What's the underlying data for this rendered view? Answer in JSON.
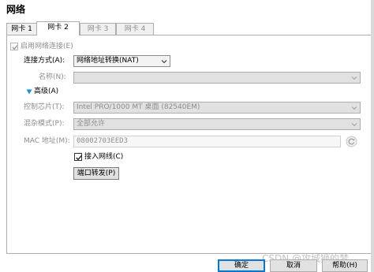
{
  "dialog": {
    "title": "网络"
  },
  "tabs": [
    {
      "label": "网卡 1",
      "state": "normal"
    },
    {
      "label": "网卡 2",
      "state": "active"
    },
    {
      "label": "网卡 3",
      "state": "disabled"
    },
    {
      "label": "网卡 4",
      "state": "disabled"
    }
  ],
  "adapter": {
    "enable_label": "启用网络连接(E)",
    "enable_checked": true,
    "attach_label": "连接方式(A):",
    "attach_value": "网络地址转换(NAT)",
    "name_label": "名称(N):",
    "name_value": "",
    "advanced_label": "高级(A)",
    "chip_label": "控制芯片(T):",
    "chip_value": "Intel PRO/1000 MT 桌面 (82540EM)",
    "promisc_label": "混杂模式(P):",
    "promisc_value": "全部允许",
    "mac_label": "MAC 地址(M):",
    "mac_value": "08002703EED3",
    "cable_label": "接入网线(C)",
    "cable_checked": true,
    "port_forward_label": "端口转发(P)"
  },
  "buttons": {
    "ok": "确定",
    "cancel": "取消",
    "help": "帮助(H)"
  },
  "watermark": "CSDN @攻城狮的梦",
  "colors": {
    "accent": "#0078d7",
    "disabled_text": "#8d8d8d"
  }
}
